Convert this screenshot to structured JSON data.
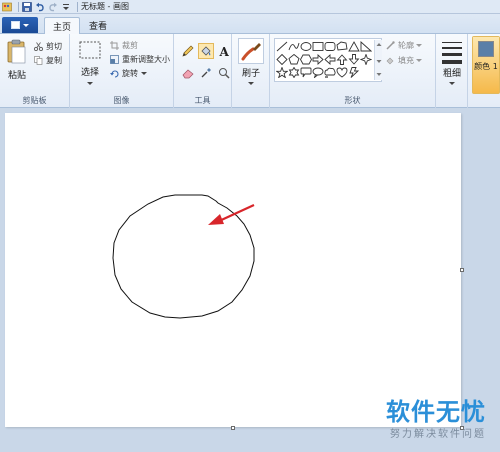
{
  "titlebar": {
    "title": "无标题 - 画图"
  },
  "tabs": {
    "home": "主页",
    "view": "查看"
  },
  "clipboard": {
    "paste": "粘贴",
    "cut": "剪切",
    "copy": "复制",
    "label": "剪贴板"
  },
  "image": {
    "select": "选择",
    "crop": "裁剪",
    "resize": "重新调整大小",
    "rotate": "旋转",
    "label": "图像"
  },
  "tools": {
    "label": "工具"
  },
  "brushes": {
    "label": "刷子"
  },
  "shapes": {
    "outline": "轮廓",
    "fill": "填充",
    "label": "形状"
  },
  "size": {
    "label": "粗细"
  },
  "colors": {
    "color1": "颜色 1",
    "color1_value": "#5a7fa8",
    "highlight": "#f5b94a"
  },
  "watermark": {
    "main": "软件无忧",
    "sub": "努力解决软件问题"
  }
}
